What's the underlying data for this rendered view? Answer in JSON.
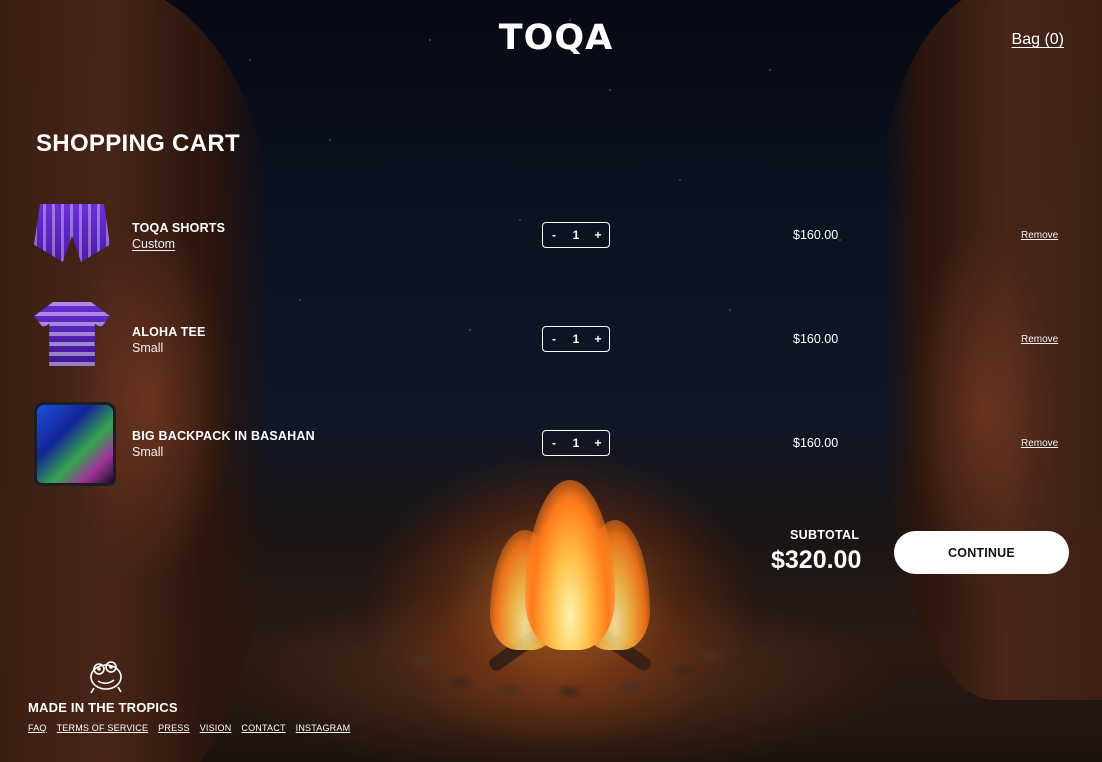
{
  "header": {
    "logo": "TOQA",
    "bag_link": "Bag (0)"
  },
  "page": {
    "title": "SHOPPING CART"
  },
  "cart": {
    "items": [
      {
        "name": "TOQA SHORTS",
        "variant": "Custom",
        "quantity": "1",
        "price": "$160.00",
        "remove_label": "Remove",
        "thumbnail": "shorts-image"
      },
      {
        "name": "ALOHA TEE",
        "variant": "Small",
        "quantity": "1",
        "price": "$160.00",
        "remove_label": "Remove",
        "thumbnail": "tee-image"
      },
      {
        "name": "BIG BACKPACK IN BASAHAN",
        "variant": "Small",
        "quantity": "1",
        "price": "$160.00",
        "remove_label": "Remove",
        "thumbnail": "backpack-image"
      }
    ],
    "stepper": {
      "decrement": "-",
      "increment": "+"
    },
    "subtotal_label": "SUBTOTAL",
    "subtotal_value": "$320.00",
    "continue_label": "CONTINUE"
  },
  "footer": {
    "tagline": "MADE IN THE TROPICS",
    "links": [
      "FAQ",
      "TERMS OF SERVICE",
      "PRESS",
      "VISION",
      "CONTACT",
      "INSTAGRAM"
    ]
  },
  "colors": {
    "text": "#ffffff",
    "button_bg": "#ffffff",
    "button_text": "#111111",
    "night_sky": "#0b1220",
    "fire": "#ff7a1a"
  },
  "icons": {
    "mascot": "frog-mascot-icon"
  }
}
